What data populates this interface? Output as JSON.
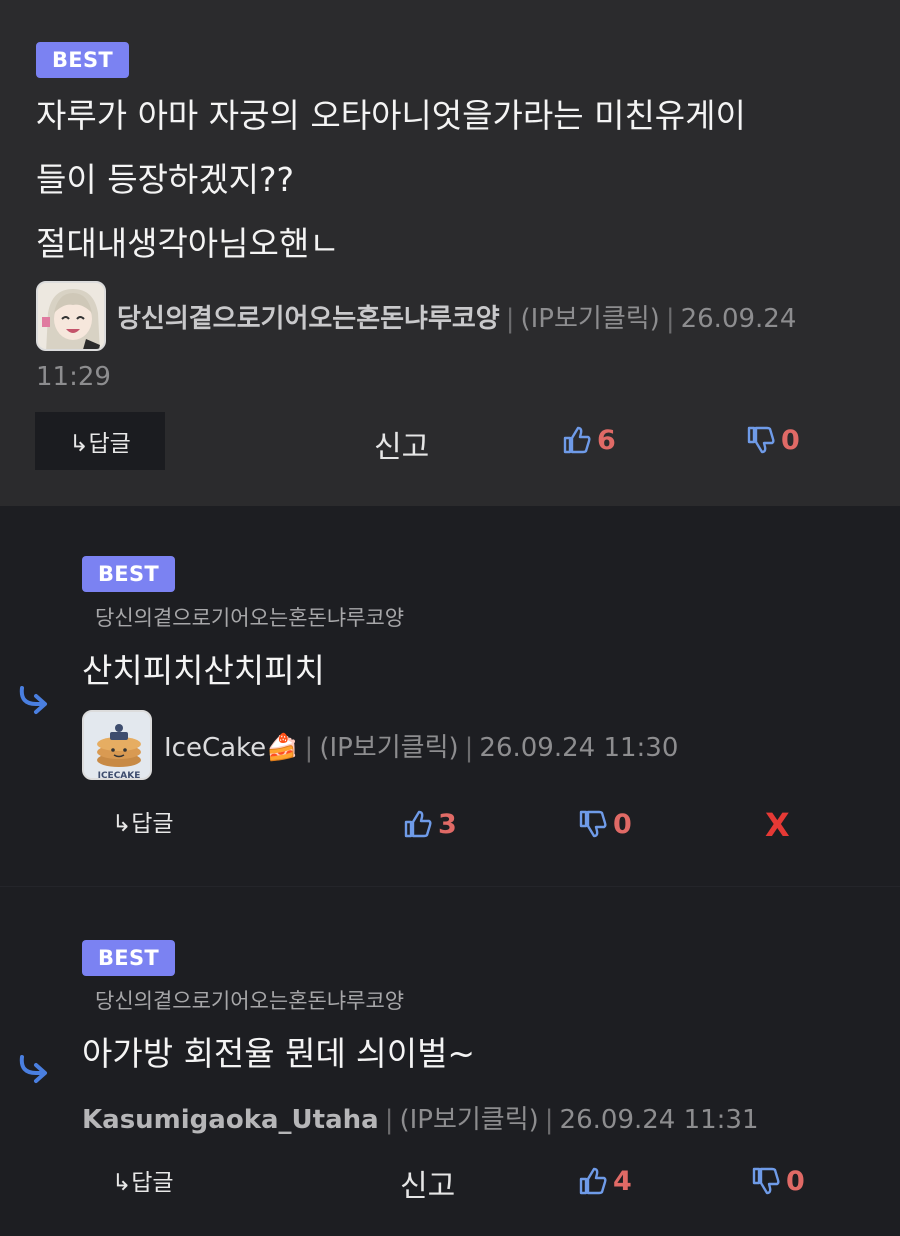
{
  "comments": [
    {
      "badge": "BEST",
      "lines": [
        "자루가 아마 자궁의 오타아니엇을가라는 미친유게이",
        "들이 등장하겠지??",
        "절대내생각아님오핸ㄴ"
      ],
      "nickname": "당신의곁으로기어오는혼돈냐루코양",
      "ip_label": "(IP보기클릭)",
      "timestamp_date": "26.09.24",
      "timestamp_time": "11:29",
      "reply_label": "↳답글",
      "report_label": "신고",
      "likes": "6",
      "dislikes": "0"
    },
    {
      "badge": "BEST",
      "reply_to": "당신의곁으로기어오는혼돈냐루코양",
      "text": "산치피치산치피치",
      "nickname": "IceCake🍰",
      "ip_label": "(IP보기클릭)",
      "timestamp": "26.09.24 11:30",
      "reply_label": "↳답글",
      "likes": "3",
      "dislikes": "0",
      "delete_label": "X"
    },
    {
      "badge": "BEST",
      "reply_to": "당신의곁으로기어오는혼돈냐루코양",
      "text": "아가방 회전율 뭔데 싀이벌~",
      "nickname": "Kasumigaoka_Utaha",
      "ip_label": "(IP보기클릭)",
      "timestamp": "26.09.24 11:31",
      "reply_label": "↳답글",
      "report_label": "신고",
      "likes": "4",
      "dislikes": "0"
    }
  ],
  "separator": "|",
  "icons": {
    "like": "thumbs-up-icon",
    "dislike": "thumbs-down-icon",
    "reply_indicator": "reply-arrow-icon"
  },
  "colors": {
    "badge": "#7b82f2",
    "count": "#e06a66",
    "icon_blue": "#6f9be8",
    "delete": "#e53935"
  }
}
